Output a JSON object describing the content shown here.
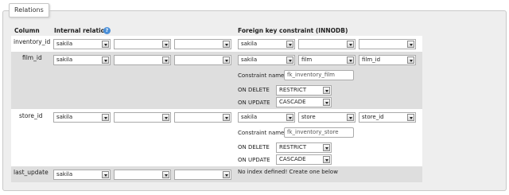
{
  "legend": "Relations",
  "headers": {
    "column": "Column",
    "internal_relation": "Internal relation",
    "help_icon_glyph": "?",
    "foreign_key": "Foreign key constraint (INNODB)"
  },
  "labels": {
    "constraint_name": "Constraint name",
    "on_delete": "ON DELETE",
    "on_update": "ON UPDATE"
  },
  "rows": [
    {
      "column": "inventory_id",
      "internal": [
        "sakila",
        "",
        ""
      ],
      "foreign": [
        "sakila",
        "",
        ""
      ]
    },
    {
      "column": "film_id",
      "internal": [
        "sakila",
        "",
        ""
      ],
      "foreign": [
        "sakila",
        "film",
        "film_id"
      ],
      "constraint_name": "fk_inventory_film",
      "on_delete": "RESTRICT",
      "on_update": "CASCADE"
    },
    {
      "column": "store_id",
      "internal": [
        "sakila",
        "",
        ""
      ],
      "foreign": [
        "sakila",
        "store",
        "store_id"
      ],
      "constraint_name": "fk_inventory_store",
      "on_delete": "RESTRICT",
      "on_update": "CASCADE"
    },
    {
      "column": "last_update",
      "internal": [
        "sakila",
        "",
        ""
      ],
      "no_index_message": "No index defined! Create one below"
    }
  ],
  "colors": {
    "dark_row": "#dedede",
    "panel": "#eeeeee",
    "help_icon": "#4a8fd8"
  }
}
